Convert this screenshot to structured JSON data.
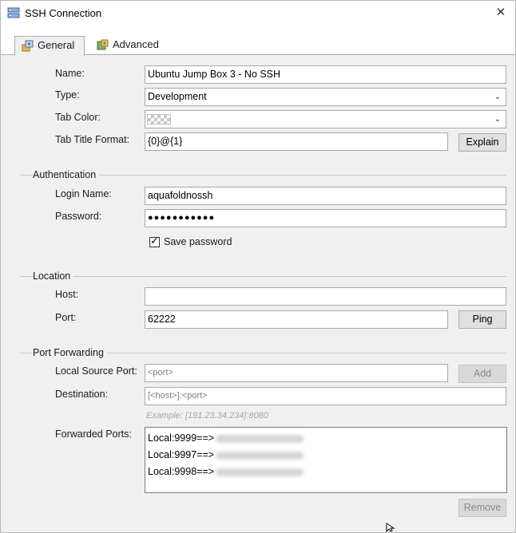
{
  "window": {
    "title": "SSH Connection",
    "close_glyph": "✕"
  },
  "tabs": [
    {
      "label": "General",
      "icon": "general-settings-icon"
    },
    {
      "label": "Advanced",
      "icon": "advanced-settings-icon"
    }
  ],
  "general": {
    "name_label": "Name:",
    "name_value": "Ubuntu Jump Box 3 - No SSH",
    "type_label": "Type:",
    "type_value": "Development",
    "tab_color_label": "Tab Color:",
    "tab_title_format_label": "Tab Title Format:",
    "tab_title_format_value": "{0}@{1}",
    "explain_button": "Explain"
  },
  "authentication": {
    "section_title": "Authentication",
    "login_label": "Login Name:",
    "login_value": "aquafoldnossh",
    "password_label": "Password:",
    "password_value": "●●●●●●●●●●●",
    "save_password_label": "Save password",
    "save_password_checked": true
  },
  "location": {
    "section_title": "Location",
    "host_label": "Host:",
    "host_value": "",
    "port_label": "Port:",
    "port_value": "62222",
    "ping_button": "Ping"
  },
  "port_forwarding": {
    "section_title": "Port Forwarding",
    "local_source_label": "Local Source Port:",
    "local_source_placeholder": "<port>",
    "add_button": "Add",
    "destination_label": "Destination:",
    "destination_placeholder": "[<host>]:<port>",
    "example_hint": "Example: [191.23.34.234]:8080",
    "forwarded_label": "Forwarded Ports:",
    "forwarded_ports": [
      "Local:9999==>",
      "Local:9997==>",
      "Local:9998==>"
    ],
    "remove_button": "Remove"
  }
}
